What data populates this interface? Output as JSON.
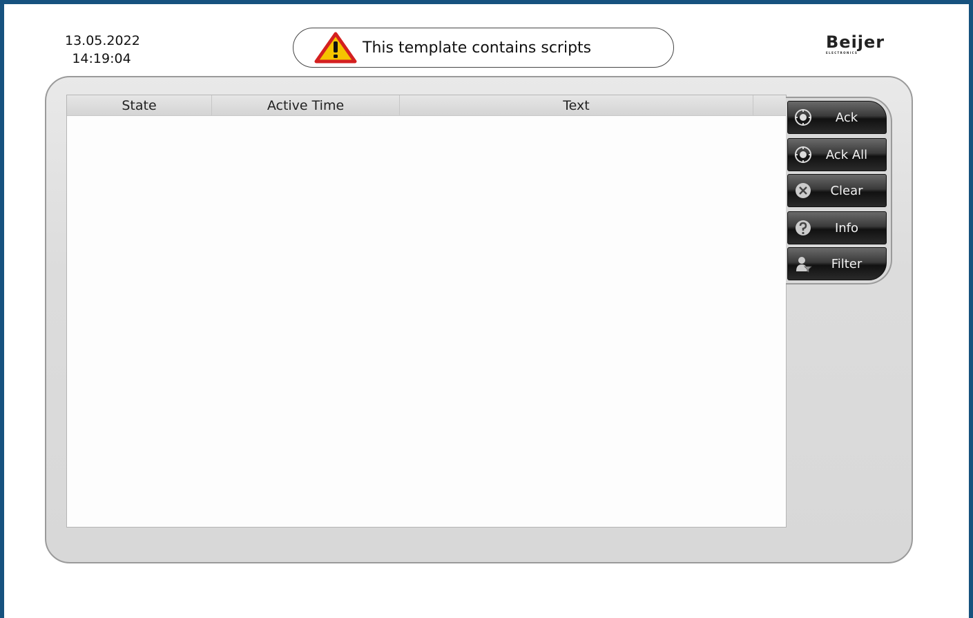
{
  "header": {
    "date": "13.05.2022",
    "time": "14:19:04",
    "banner_text": "This template contains scripts",
    "banner_icon": "warning-icon",
    "logo_text": "Beijer",
    "logo_subtext": "ELECTRONICS"
  },
  "alarm_list": {
    "columns": [
      "State",
      "Active Time",
      "Text"
    ],
    "rows": []
  },
  "buttons": [
    {
      "label": "Ack",
      "icon": "ack-icon"
    },
    {
      "label": "Ack All",
      "icon": "ack-all-icon"
    },
    {
      "label": "Clear",
      "icon": "clear-icon"
    },
    {
      "label": "Info",
      "icon": "info-icon"
    },
    {
      "label": "Filter",
      "icon": "filter-icon"
    }
  ],
  "colors": {
    "frame_border": "#17527f",
    "warning_triangle": "#d42020",
    "warning_fill": "#f5c400"
  }
}
